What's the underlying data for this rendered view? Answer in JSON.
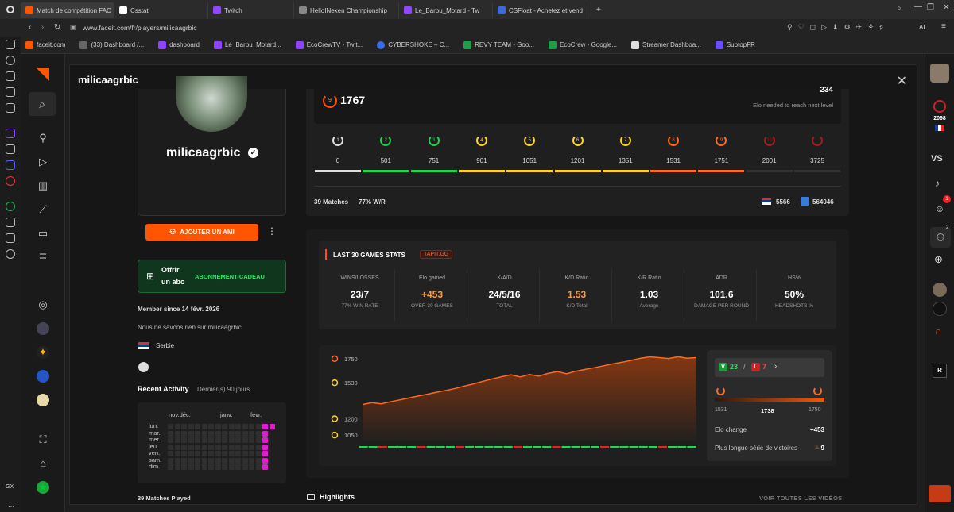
{
  "browser": {
    "tabs": [
      {
        "label": "Match de compétition FAC",
        "color": "#ff5500",
        "active": true
      },
      {
        "label": "Csstat",
        "color": "#ffffff"
      },
      {
        "label": "Twitch",
        "color": "#9146ff"
      },
      {
        "label": "HelloINexen Championship",
        "color": "#ffffff"
      },
      {
        "label": "Le_Barbu_Motard - Tw",
        "color": "#9146ff"
      },
      {
        "label": "CSFloat - Achetez et vend",
        "color": "#3a6bd6"
      }
    ],
    "url": "www.faceit.com/fr/players/milicaagrbic",
    "bookmarks": [
      "faceit.com",
      "(33) Dashboard /...",
      "dashboard",
      "Le_Barbu_Motard...",
      "EcoCrewTV - Twit...",
      "CYBERSHOKE – C...",
      "REVY TEAM - Goo...",
      "EcoCrew - Google...",
      "Streamer Dashboa...",
      "SubtopFR"
    ]
  },
  "modal": {
    "title": "milicaagrbic",
    "close_icon": "close-icon"
  },
  "profile": {
    "name": "milicaagrbic",
    "add_friend": "AJOUTER UN AMI",
    "gift_offer": "Offrir",
    "gift_sub": "un abo",
    "gift_label": "ABONNEMENT-CADEAU",
    "member_since": "Member since 14 févr. 2026",
    "bio": "Nous ne savons rien sur milicaagrbic",
    "country": "Serbie",
    "recent_activity": "Recent Activity",
    "recent_period": "Dernier(s) 90 jours",
    "months": [
      "nov.déc.",
      "janv.",
      "févr."
    ],
    "days": [
      "lun.",
      "mar.",
      "mer.",
      "jeu.",
      "ven.",
      "sam.",
      "dim."
    ],
    "matches_played": "39 Matches Played"
  },
  "elo": {
    "level": "9",
    "current": "1767",
    "needed": "234",
    "needed_label": "Elo needed to reach next level",
    "levels": [
      {
        "lvl": "1",
        "elo": "0",
        "color": "#dddddd"
      },
      {
        "lvl": "2",
        "elo": "501",
        "color": "#1fd34a"
      },
      {
        "lvl": "3",
        "elo": "751",
        "color": "#1fd34a"
      },
      {
        "lvl": "4",
        "elo": "901",
        "color": "#ffd21f"
      },
      {
        "lvl": "5",
        "elo": "1051",
        "color": "#ffd21f"
      },
      {
        "lvl": "6",
        "elo": "1201",
        "color": "#ffd21f"
      },
      {
        "lvl": "7",
        "elo": "1351",
        "color": "#ffd21f"
      },
      {
        "lvl": "8",
        "elo": "1531",
        "color": "#ff6a1f"
      },
      {
        "lvl": "9",
        "elo": "1751",
        "color": "#ff6a1f"
      },
      {
        "lvl": "10",
        "elo": "2001",
        "color": "#a51c1c"
      },
      {
        "lvl": "",
        "elo": "3725",
        "color": "#a51c1c"
      }
    ],
    "matches": "39 Matches",
    "winrate": "77% W/R",
    "country_rank": "5566",
    "global_rank": "564046"
  },
  "last30": {
    "title": "LAST 30 GAMES STATS",
    "tag": "TAPIT.GG",
    "stats": [
      {
        "t": "WINS/LOSSES",
        "v": "23/7",
        "s": "77% WIN RATE",
        "c": "#ffffff"
      },
      {
        "t": "Elo gained",
        "v": "+453",
        "s": "OVER 30 GAMES",
        "c": "#ff9a3c"
      },
      {
        "t": "K/A/D",
        "v": "24/5/16",
        "s": "TOTAL",
        "c": "#ffffff"
      },
      {
        "t": "K/D Ratio",
        "v": "1.53",
        "s": "K/D Total",
        "c": "#ff9a3c"
      },
      {
        "t": "K/R Ratio",
        "v": "1.03",
        "s": "Average",
        "c": "#ffffff"
      },
      {
        "t": "ADR",
        "v": "101.6",
        "s": "DAMAGE PER ROUND",
        "c": "#ffffff"
      },
      {
        "t": "HS%",
        "v": "50%",
        "s": "HEADSHOTS %",
        "c": "#ffffff"
      }
    ]
  },
  "chart_data": {
    "type": "area",
    "title": "",
    "xlabel": "",
    "ylabel": "",
    "y_ticks": [
      1750,
      1530,
      1200,
      1050
    ],
    "ylim": [
      1000,
      1800
    ],
    "values": [
      1330,
      1347,
      1337,
      1355,
      1372,
      1390,
      1408,
      1425,
      1443,
      1460,
      1478,
      1500,
      1520,
      1543,
      1565,
      1585,
      1603,
      1583,
      1605,
      1590,
      1615,
      1632,
      1612,
      1635,
      1652,
      1668,
      1685,
      1703,
      1718,
      1735,
      1755,
      1767,
      1760,
      1752,
      1768,
      1755,
      1760
    ],
    "results": [
      "W",
      "W",
      "L",
      "W",
      "W",
      "W",
      "L",
      "W",
      "W",
      "W",
      "L",
      "W",
      "W",
      "W",
      "W",
      "W",
      "L",
      "W",
      "W",
      "W",
      "L",
      "W",
      "W",
      "W",
      "W",
      "L",
      "W",
      "W",
      "W",
      "W",
      "W",
      "L",
      "W",
      "W",
      "W"
    ]
  },
  "summary": {
    "wins": "23",
    "losses": "7",
    "elo_low": "1531",
    "elo_mid": "1738",
    "elo_high": "1750",
    "elo_change_label": "Elo change",
    "elo_change": "+453",
    "streak_label": "Plus longue série de victoires",
    "streak": "9"
  },
  "highlights": {
    "title": "Highlights",
    "view_all": "VOIR TOUTES LES VIDÉOS"
  },
  "right_bar": {
    "elo": "2098",
    "vs": "VS",
    "notif": "1",
    "party": "2"
  }
}
